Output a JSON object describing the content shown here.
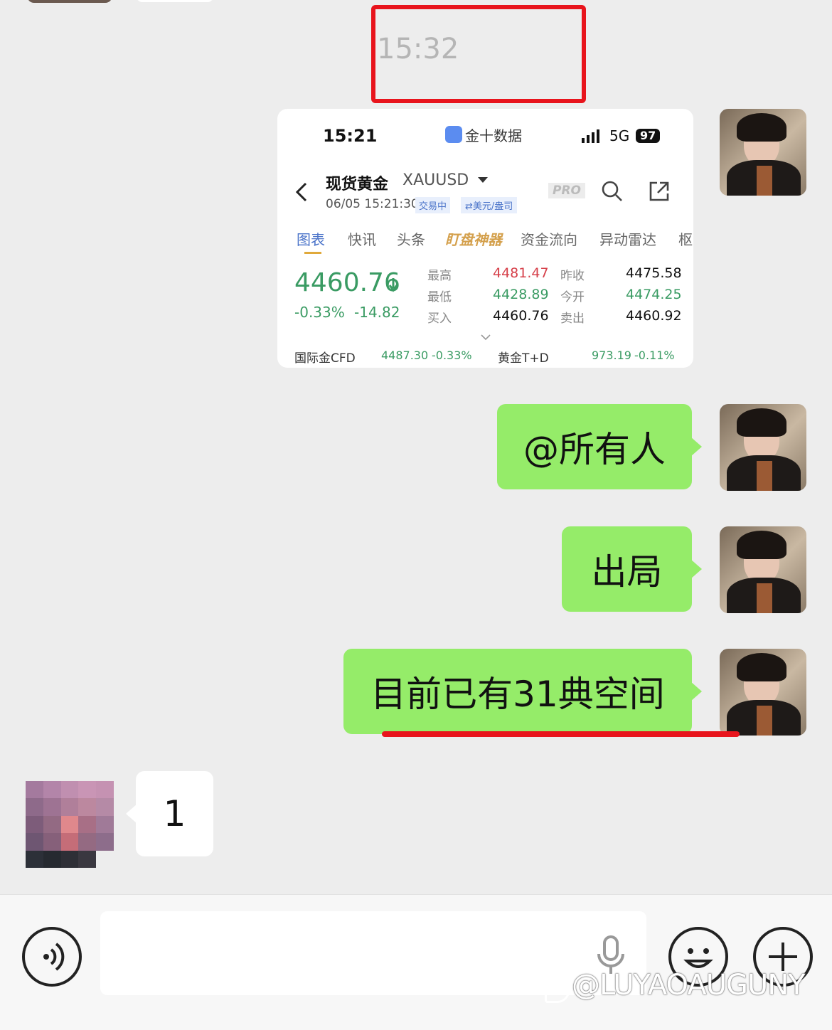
{
  "chat": {
    "timestamp": "15:32",
    "messages": [
      {
        "type": "image",
        "from": "me"
      },
      {
        "type": "text",
        "from": "me",
        "text": "@所有人"
      },
      {
        "type": "text",
        "from": "me",
        "text": "出局"
      },
      {
        "type": "text",
        "from": "me",
        "text": "目前已有31典空间"
      },
      {
        "type": "text",
        "from": "other",
        "text": "1"
      }
    ]
  },
  "screenshot": {
    "status_time": "15:21",
    "app_name": "金十数据",
    "network": "5G",
    "battery": "97",
    "instrument_name": "现货黄金",
    "instrument_code": "XAUUSD",
    "datetime": "06/05 15:21:30",
    "trading_status": "交易中",
    "currency_tag": "⇄美元/盎司",
    "pro_label": "PRO",
    "tabs": [
      "图表",
      "快讯",
      "头条",
      "盯盘神器",
      "资金流向",
      "异动雷达",
      "枢"
    ],
    "price": "4460.76",
    "change_pct": "-0.33%",
    "change_abs": "-14.82",
    "stats": {
      "high_label": "最高",
      "high": "4481.47",
      "low_label": "最低",
      "low": "4428.89",
      "bid_label": "买入",
      "bid": "4460.76",
      "prev_close_label": "昨收",
      "prev_close": "4475.58",
      "open_label": "今开",
      "open": "4474.25",
      "ask_label": "卖出",
      "ask": "4460.92"
    },
    "ticker": {
      "cfd_label": "国际金CFD",
      "cfd_value": "4487.30",
      "cfd_change": "-0.33%",
      "td_label": "黄金T+D",
      "td_value": "973.19",
      "td_change": "-0.11%"
    }
  },
  "watermark": "@LUYAOAUGUNY",
  "colors": {
    "bubble_green": "#95ec69",
    "price_green": "#3a9b63",
    "price_red": "#d6404a",
    "annotation_red": "#e8141c"
  }
}
